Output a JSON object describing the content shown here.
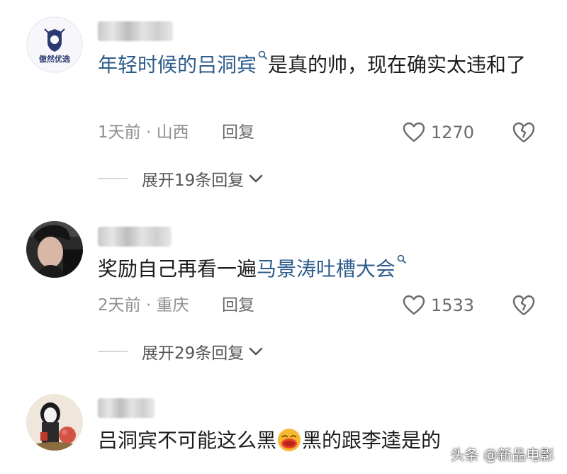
{
  "comments": [
    {
      "avatar_text": "傲然优选",
      "content_tag": "年轻时候的吕洞宾",
      "content_rest": "是真的帅，现在确实太违和了",
      "time_location": "1天前 · 山西",
      "reply_label": "回复",
      "likes": "1270",
      "expand_label": "展开19条回复"
    },
    {
      "content_plain": "奖励自己再看一遍",
      "content_tag": "马景涛吐槽大会",
      "time_location": "2天前 · 重庆",
      "reply_label": "回复",
      "likes": "1533",
      "expand_label": "展开29条回复"
    },
    {
      "content_before_emoji": "吕洞宾不可能这么黑",
      "content_after_emoji": "黑的跟李逵是的"
    }
  ],
  "watermark": "头条 @新品电影",
  "colors": {
    "tag": "#2f5d8a",
    "meta": "#8f8f8f",
    "text": "#1c1c1c"
  }
}
